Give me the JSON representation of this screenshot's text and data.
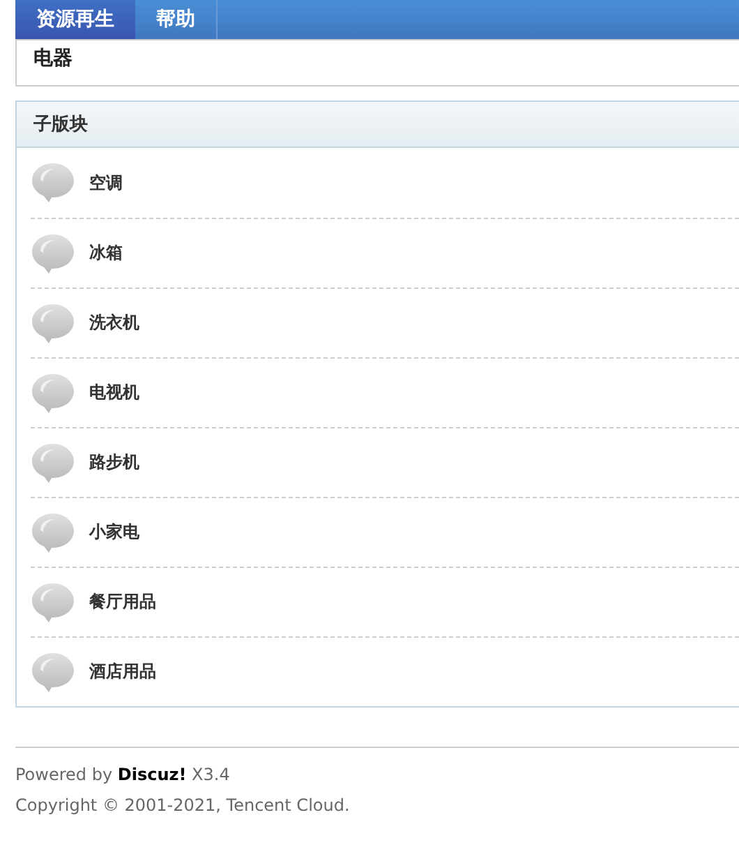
{
  "nav": {
    "tabs": [
      {
        "label": "资源再生",
        "selected": true
      },
      {
        "label": "帮助",
        "selected": false
      }
    ]
  },
  "forum": {
    "title": "电器"
  },
  "subforums": {
    "heading": "子版块",
    "items": [
      {
        "name": "空调"
      },
      {
        "name": "冰箱"
      },
      {
        "name": "洗衣机"
      },
      {
        "name": "电视机"
      },
      {
        "name": "路步机"
      },
      {
        "name": "小家电"
      },
      {
        "name": "餐厅用品"
      },
      {
        "name": "酒店用品"
      }
    ]
  },
  "footer": {
    "powered": "Powered by **Discuz!** X3.4",
    "copyright": "Copyright © 2001-2021, Tencent Cloud."
  }
}
